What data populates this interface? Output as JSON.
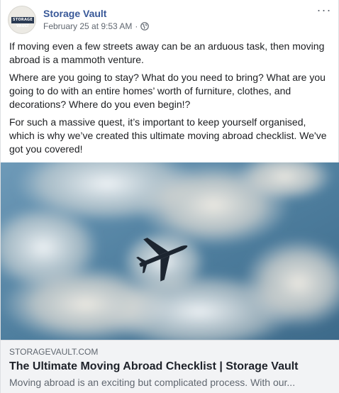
{
  "post": {
    "page_name": "Storage Vault",
    "timestamp": "February 25 at 9:53 AM",
    "separator": "·",
    "avatar_text": "STORAGE VAULT",
    "paragraphs": [
      "If moving even a few streets away can be an arduous task, then moving abroad is a mammoth venture.",
      "Where are you going to stay? What do you need to bring? What are you going to do with an entire homes’ worth of furniture, clothes, and decorations? Where do you even begin!?",
      "For such a massive quest, it’s important to keep yourself organised, which is why we’ve created this ultimate moving abroad checklist. We've got you covered!"
    ],
    "more_glyph": "···"
  },
  "link": {
    "domain": "STORAGEVAULT.COM",
    "title": "The Ultimate Moving Abroad Checklist | Storage Vault",
    "description": "Moving abroad is an exciting but complicated process. With our..."
  },
  "icons": {
    "globe": "globe-icon",
    "more": "more-options-icon",
    "airplane": "airplane-icon"
  },
  "colors": {
    "page_name": "#385898",
    "meta": "#606770",
    "link_panel": "#f2f3f5",
    "sky": "#5a88a8"
  }
}
